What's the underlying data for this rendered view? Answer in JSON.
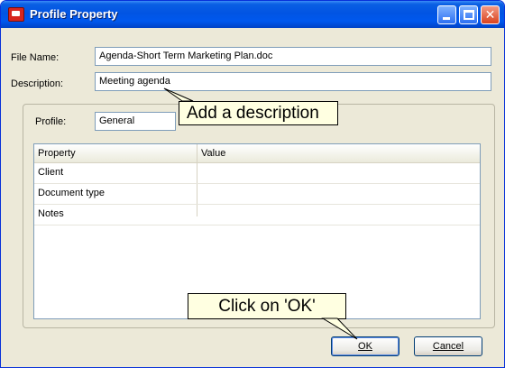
{
  "window": {
    "title": "Profile Property"
  },
  "form": {
    "file_name_label": "File Name:",
    "file_name_value": "Agenda-Short Term Marketing Plan.doc",
    "description_label": "Description:",
    "description_value": "Meeting agenda",
    "profile_label": "Profile:",
    "profile_value": "General"
  },
  "grid": {
    "columns": [
      "Property",
      "Value"
    ],
    "rows": [
      {
        "property": "Client",
        "value": ""
      },
      {
        "property": "Document type",
        "value": ""
      },
      {
        "property": "Notes",
        "value": ""
      }
    ]
  },
  "buttons": {
    "ok": "OK",
    "cancel": "Cancel"
  },
  "callouts": {
    "add_description": "Add a description",
    "click_ok": "Click on 'OK'"
  },
  "colors": {
    "title_bar": "#0054e3",
    "dialog_bg": "#ece9d8",
    "callout_bg": "#ffffe1",
    "close_button": "#d9431f"
  },
  "icons": [
    "profile-app-icon",
    "minimize-icon",
    "maximize-icon",
    "close-icon"
  ]
}
